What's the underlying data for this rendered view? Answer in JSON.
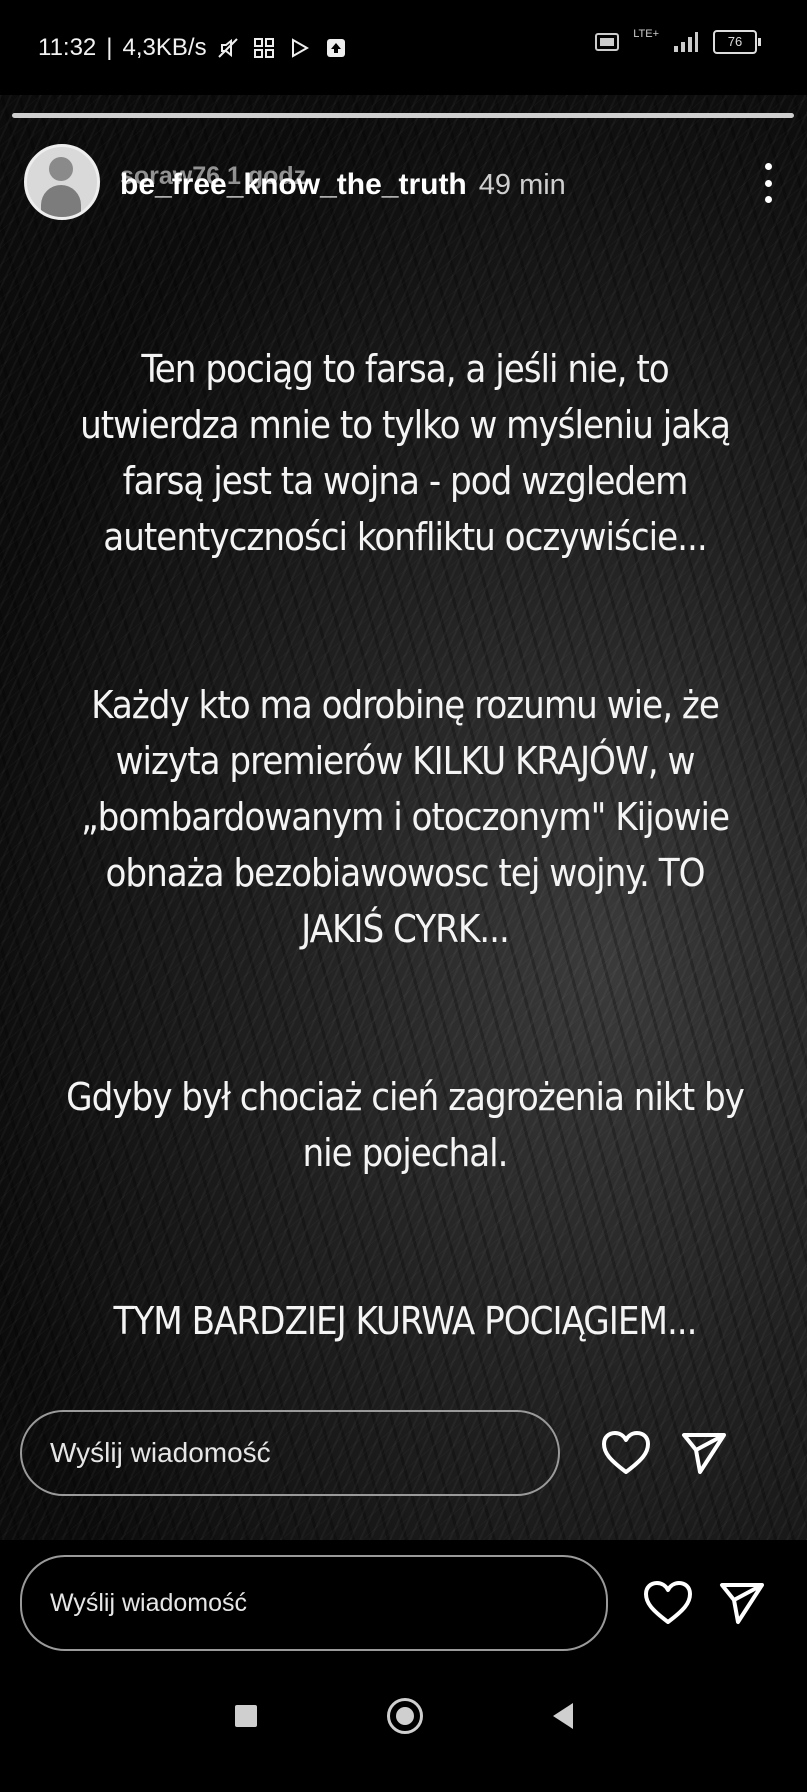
{
  "status_bar": {
    "time": "11:32",
    "speed": "4,3KB/s",
    "network": "LTE+",
    "battery": "76",
    "icons": [
      "muted-icon",
      "grid-app-icon",
      "play-store-icon",
      "upload-icon",
      "volte-icon",
      "signal-icon",
      "battery-icon"
    ]
  },
  "story": {
    "username_overlay": "soraw76  1 godz.",
    "username": "be_free_know_the_truth",
    "time_ago": "49 min",
    "paragraphs": [
      "Ten pociąg to farsa, a jeśli nie, to utwierdza mnie to tylko w myśleniu jaką farsą jest ta wojna - pod wzgledem autentyczności konfliktu oczywiście...",
      "Każdy kto ma odrobinę rozumu wie, że wizyta premierów KILKU KRAJÓW, w „bombardowanym i otoczonym\" Kijowie obnaża bezobiawowosc tej wojny. TO JAKIŚ CYRK...",
      "Gdyby był chociaż cień zagrożenia nikt by nie pojechal.",
      "TYM BARDZIEJ KURWA POCIĄGIEM..."
    ]
  },
  "reply_bars": [
    {
      "placeholder": "Wyślij wiadomość"
    },
    {
      "placeholder": "Wyślij wiadomość"
    }
  ],
  "colors": {
    "background": "#000000",
    "text": "#f4f4f4",
    "input_border": "#9a9a9a"
  }
}
